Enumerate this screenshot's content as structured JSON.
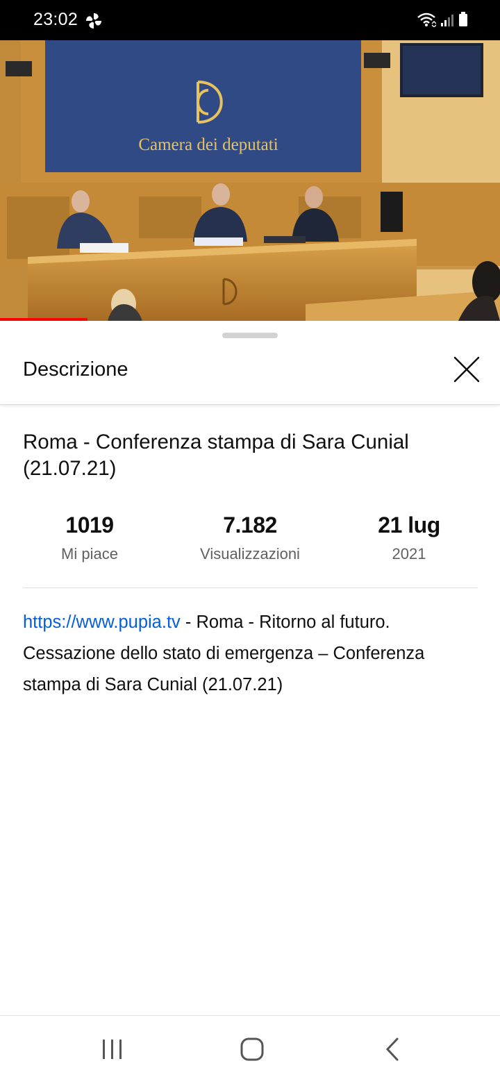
{
  "status_bar": {
    "time": "23:02",
    "app_icon": "pinwheel-icon",
    "icons": [
      "wifi-icon",
      "signal-icon",
      "battery-icon"
    ]
  },
  "video": {
    "backdrop_text": "Camera dei deputati",
    "progress": 0.175,
    "accent_color": "#ff0000"
  },
  "sheet": {
    "title": "Descrizione",
    "close_icon": "close-icon"
  },
  "video_info": {
    "title": "Roma - Conferenza stampa di Sara Cunial (21.07.21)",
    "stats": [
      {
        "value": "1019",
        "label": "Mi piace"
      },
      {
        "value": "7.182",
        "label": "Visualizzazioni"
      },
      {
        "value": "21 lug",
        "label": "2021"
      }
    ],
    "description_link": "https://www.pupia.tv",
    "description_text": " - Roma - Ritorno al futuro. Cessazione dello stato di emergenza – Conferenza stampa di Sara Cunial (21.07.21)",
    "link_color": "#065fd4"
  },
  "nav_bar": {
    "buttons": [
      "recents-icon",
      "home-icon",
      "back-icon"
    ]
  }
}
